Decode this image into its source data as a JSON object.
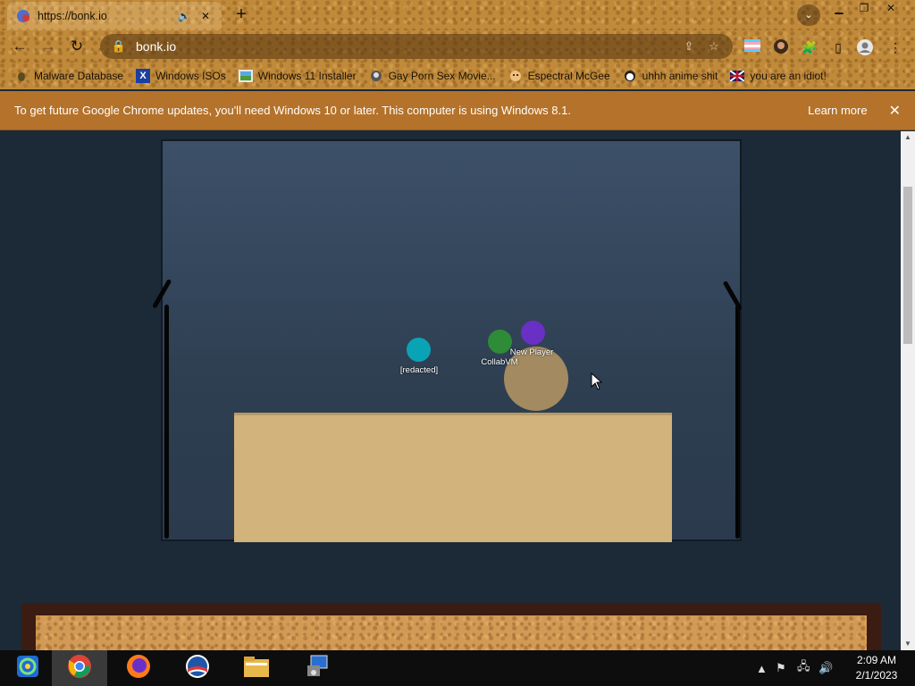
{
  "browser": {
    "tab_title": "https://bonk.io",
    "url": "bonk.io",
    "new_tab": "+",
    "tab_search": "⌄"
  },
  "bookmarks": [
    {
      "label": "Malware Database",
      "icon": "bug-icon"
    },
    {
      "label": "Windows ISOs",
      "icon": "x-logo-icon"
    },
    {
      "label": "Windows 11 Installer",
      "icon": "image-icon"
    },
    {
      "label": "Gay Porn Sex Movie...",
      "icon": "user-icon"
    },
    {
      "label": "Espectral McGee",
      "icon": "face-icon"
    },
    {
      "label": "uhhh anime shit",
      "icon": "anime-icon"
    },
    {
      "label": "you are an idiot!",
      "icon": "flag-icon"
    }
  ],
  "infobar": {
    "message": "To get future Google Chrome updates, you'll need Windows 10 or later. This computer is using Windows 8.1.",
    "learn_more": "Learn more",
    "close": "✕"
  },
  "game": {
    "players": [
      {
        "name": "[redacted]",
        "color": "#0aa3b5"
      },
      {
        "name": "CollabVM",
        "color": "#2e8b37"
      },
      {
        "name": "New Player",
        "color": "#6a2fc4"
      }
    ],
    "colors": {
      "background": "#34475c",
      "platform": "#d2b37c",
      "big_ball": "#a38a60",
      "walls": "#050505"
    }
  },
  "taskbar": {
    "apps": [
      "ie-icon",
      "chrome-icon",
      "firefox-icon",
      "obama-icon",
      "folder-icon",
      "installer-icon"
    ],
    "time": "2:09 AM",
    "date": "2/1/2023"
  }
}
